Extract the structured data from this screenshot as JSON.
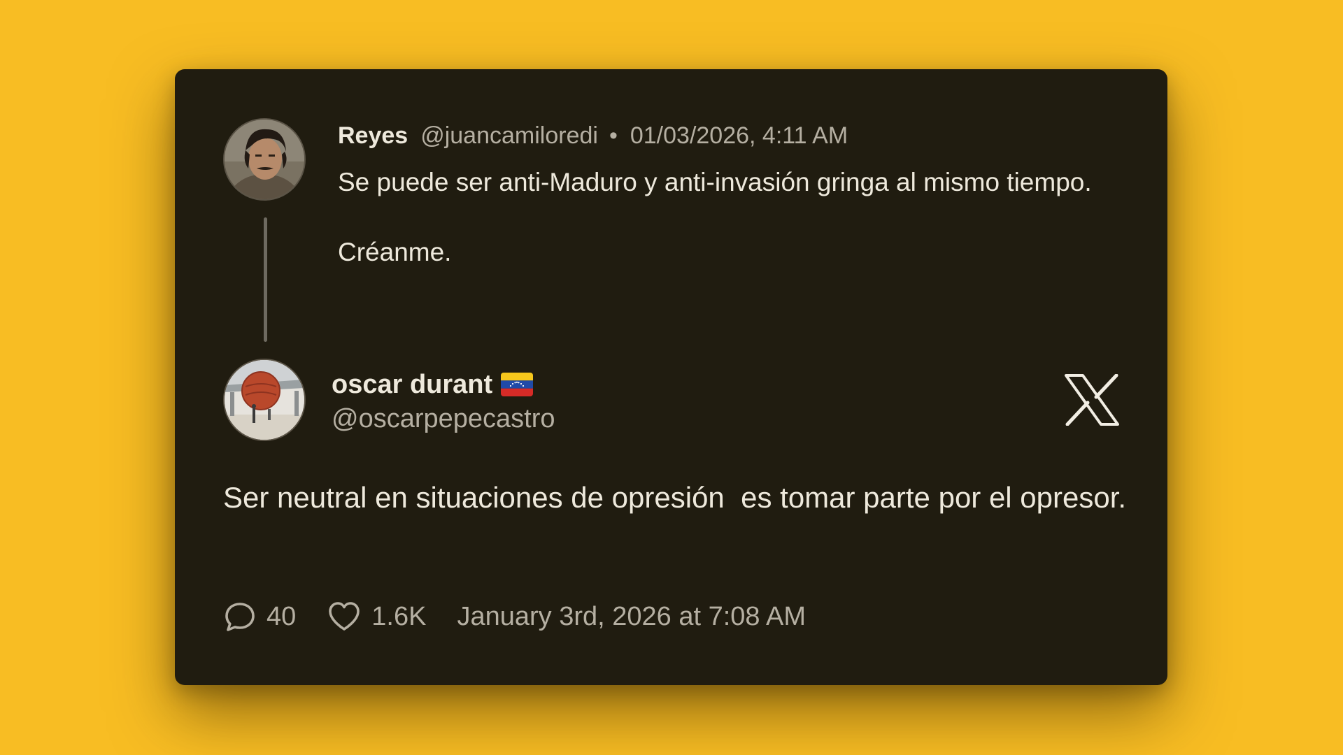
{
  "parent_tweet": {
    "name": "Reyes",
    "handle": "@juancamiloredi",
    "separator": "•",
    "timestamp": "01/03/2026, 4:11 AM",
    "text": "Se puede ser anti-Maduro y anti-invasión gringa al mismo tiempo.\n\nCréanme.",
    "avatar_icon": "user-avatar-photo"
  },
  "main_tweet": {
    "name": "oscar durant",
    "flag_icon": "venezuela-flag-icon",
    "handle": "@oscarpepecastro",
    "text": "Ser neutral en situaciones de opresión  es tomar parte por el opresor.",
    "avatar_icon": "user-avatar-photo",
    "platform_icon": "x-logo-icon"
  },
  "footer": {
    "replies": "40",
    "likes": "1.6K",
    "date": "January 3rd, 2026 at 7:08 AM",
    "reply_icon": "speech-bubble-icon",
    "like_icon": "heart-icon"
  },
  "colors": {
    "background": "#f8bd23",
    "card": "#201c10",
    "primary_text": "#eee9dc",
    "secondary_text": "#b5afa2"
  }
}
